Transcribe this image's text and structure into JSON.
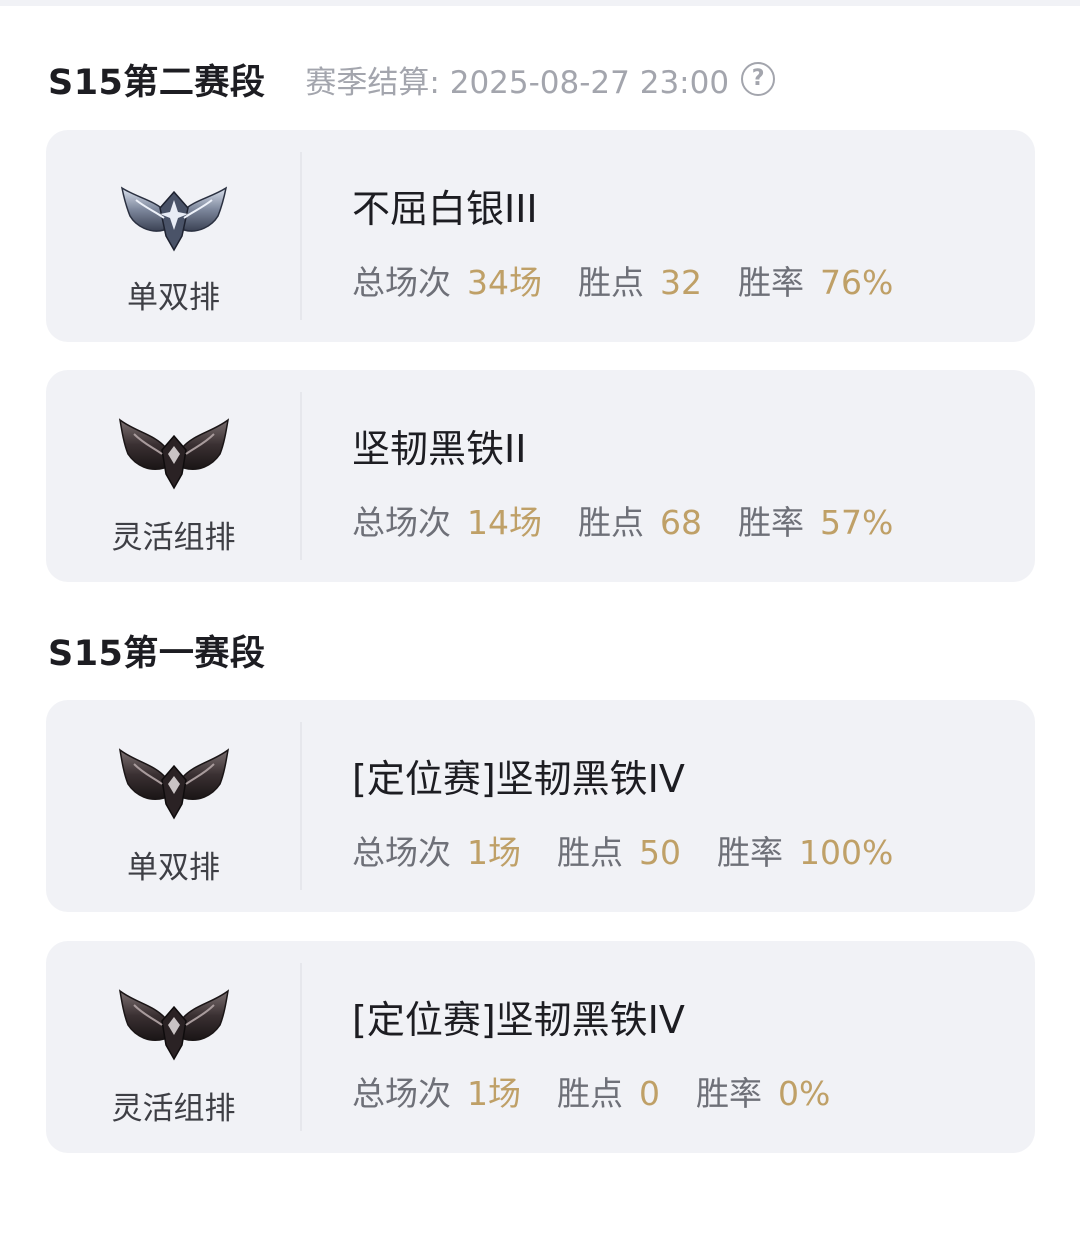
{
  "sections": [
    {
      "title": "S15第二赛段",
      "settlement_text": "赛季结算: 2025-08-27 23:00",
      "help_icon": "question-circle-icon",
      "cards": [
        {
          "queue": "单双排",
          "emblem": "silver-emblem-icon",
          "rank": "不屈白银III",
          "stats": {
            "games_label": "总场次",
            "games_value": "34场",
            "lp_label": "胜点",
            "lp_value": "32",
            "winrate_label": "胜率",
            "winrate_value": "76%"
          }
        },
        {
          "queue": "灵活组排",
          "emblem": "iron-emblem-icon",
          "rank": "坚韧黑铁II",
          "stats": {
            "games_label": "总场次",
            "games_value": "14场",
            "lp_label": "胜点",
            "lp_value": "68",
            "winrate_label": "胜率",
            "winrate_value": "57%"
          }
        }
      ]
    },
    {
      "title": "S15第一赛段",
      "cards": [
        {
          "queue": "单双排",
          "emblem": "iron-emblem-icon",
          "rank": "[定位赛]坚韧黑铁IV",
          "stats": {
            "games_label": "总场次",
            "games_value": "1场",
            "lp_label": "胜点",
            "lp_value": "50",
            "winrate_label": "胜率",
            "winrate_value": "100%"
          }
        },
        {
          "queue": "灵活组排",
          "emblem": "iron-emblem-icon",
          "rank": "[定位赛]坚韧黑铁IV",
          "stats": {
            "games_label": "总场次",
            "games_value": "1场",
            "lp_label": "胜点",
            "lp_value": "0",
            "winrate_label": "胜率",
            "winrate_value": "0%"
          }
        }
      ]
    }
  ],
  "colors": {
    "card_bg": "#f1f2f6",
    "stat_value": "#bfa067",
    "muted_text": "#a3a5ad"
  }
}
